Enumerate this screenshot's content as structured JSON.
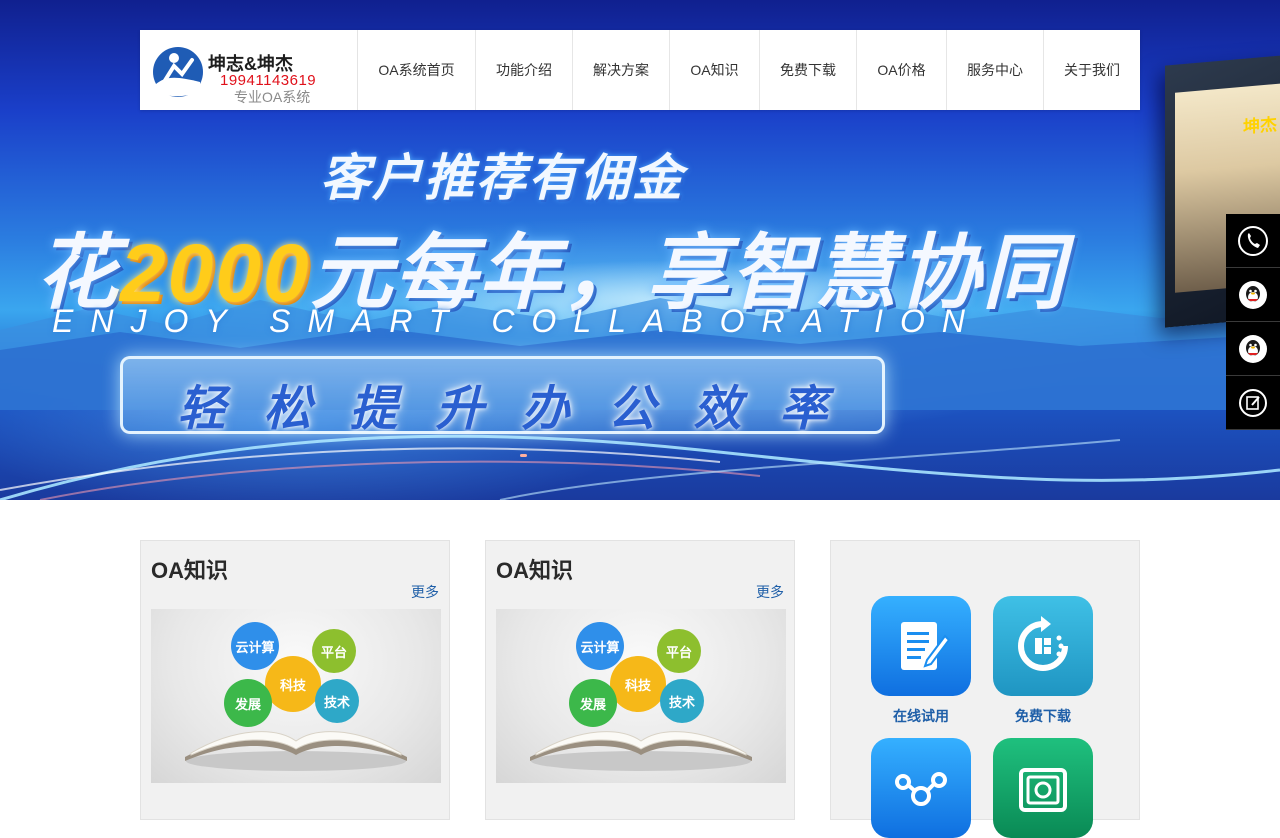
{
  "brand": {
    "name": "坤志&坤杰",
    "phone": "19941143619",
    "tagline": "专业OA系统"
  },
  "nav": [
    {
      "label": "OA系统首页"
    },
    {
      "label": "功能介绍"
    },
    {
      "label": "解决方案"
    },
    {
      "label": "OA知识"
    },
    {
      "label": "免费下载"
    },
    {
      "label": "OA价格"
    },
    {
      "label": "服务中心"
    },
    {
      "label": "关于我们"
    }
  ],
  "hero": {
    "line1": "客户推荐有佣金",
    "line2_prefix": "花",
    "line2_highlight": "2000",
    "line2_suffix": "元每年，享智慧协同",
    "line3": "ENJOY SMART COLLABORATION",
    "line4": "轻松提升办公效率",
    "monitor_text": "坤杰"
  },
  "side_float": [
    {
      "icon": "phone-icon"
    },
    {
      "icon": "qq-icon"
    },
    {
      "icon": "qq-icon"
    },
    {
      "icon": "edit-icon"
    }
  ],
  "cards": [
    {
      "title": "OA知识",
      "more": "更多",
      "bubbles": [
        "云计算",
        "平台",
        "科技",
        "发展",
        "技术"
      ]
    },
    {
      "title": "OA知识",
      "more": "更多",
      "bubbles": [
        "云计算",
        "平台",
        "科技",
        "发展",
        "技术"
      ]
    }
  ],
  "apps": [
    {
      "label": "在线试用",
      "icon": "document-icon",
      "color": "#1a8ef0"
    },
    {
      "label": "免费下载",
      "icon": "refresh-icon",
      "color": "#27a6cf"
    },
    {
      "label": "",
      "icon": "network-icon",
      "color": "#1a8ef0"
    },
    {
      "label": "",
      "icon": "safe-icon",
      "color": "#12a36a"
    }
  ]
}
